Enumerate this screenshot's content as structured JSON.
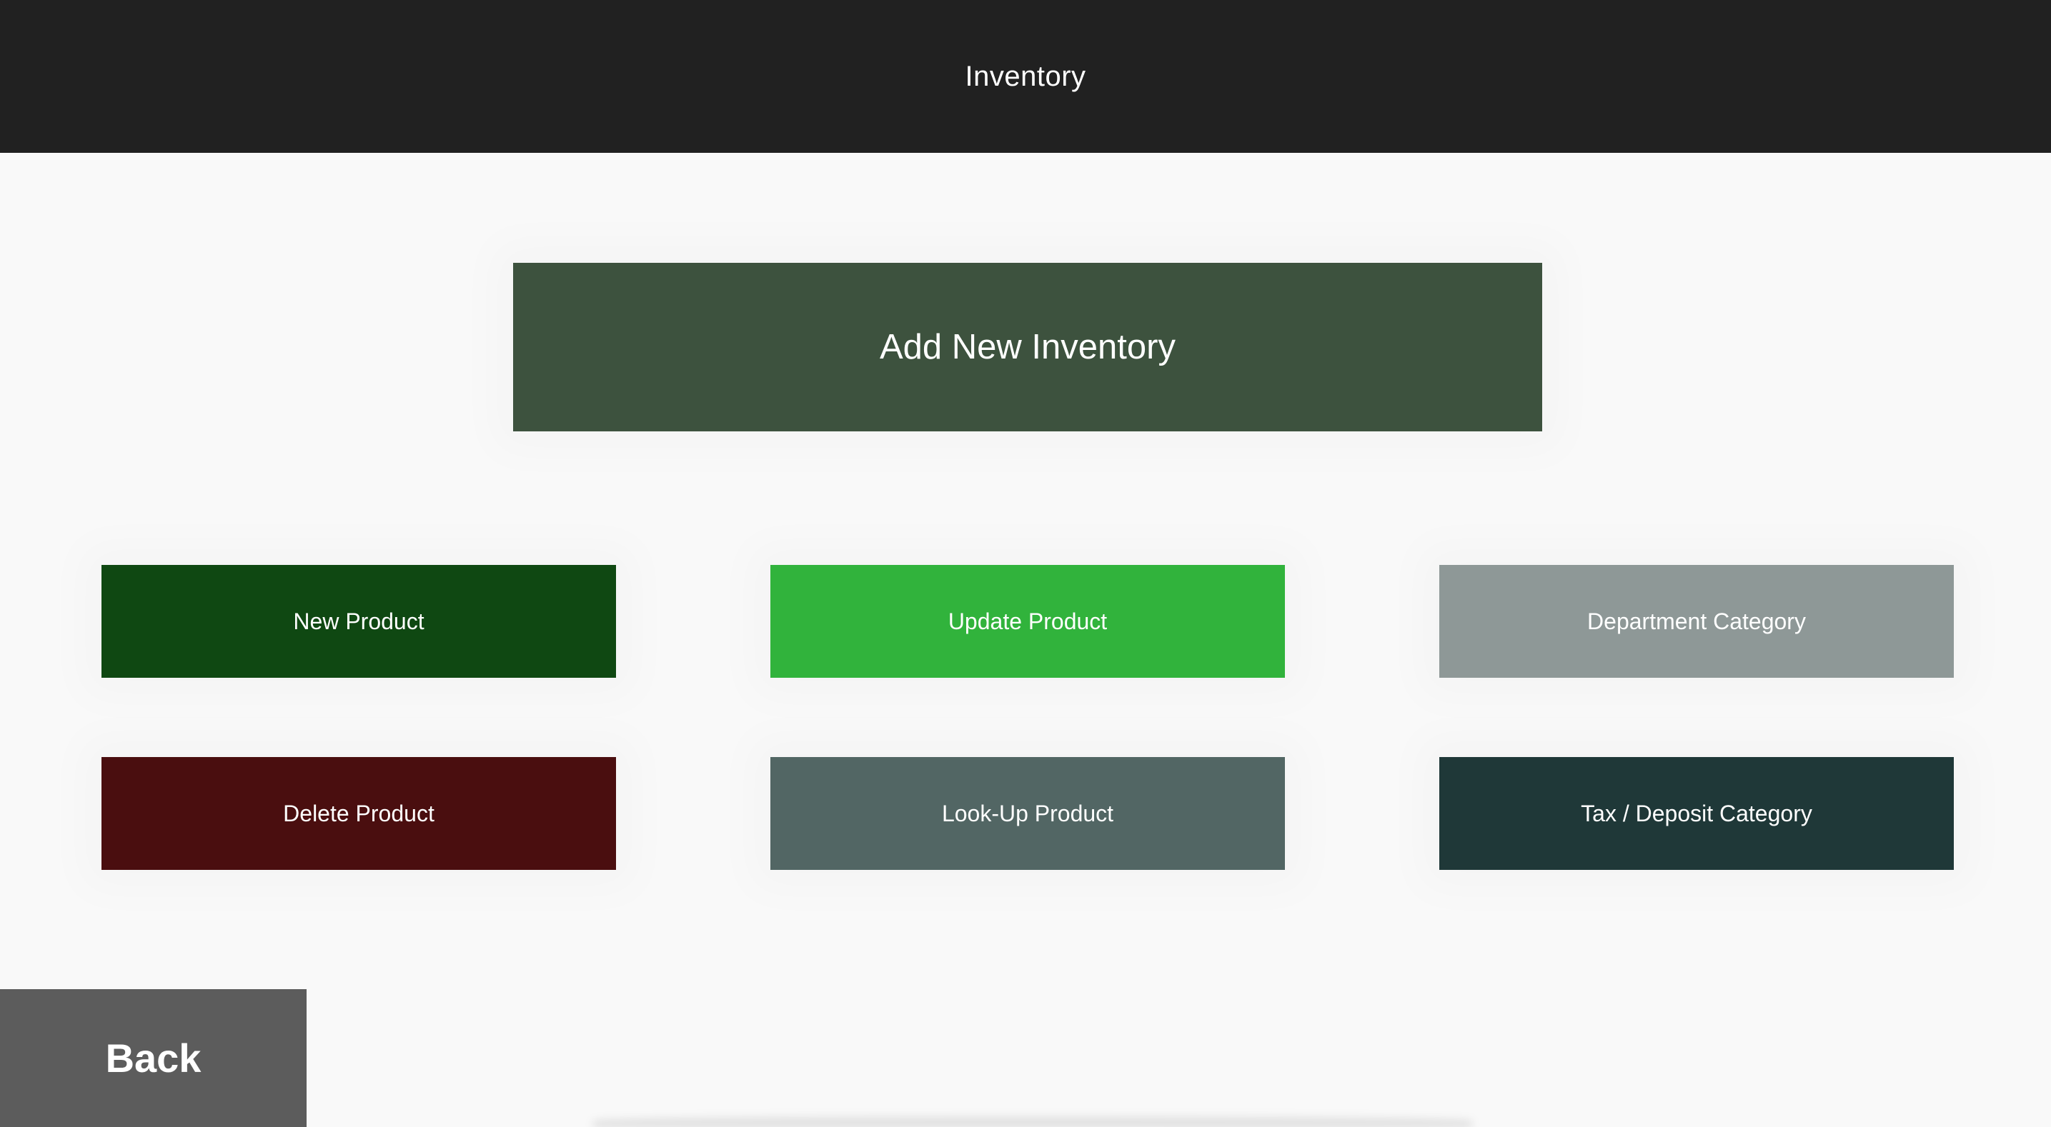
{
  "header": {
    "title": "Inventory"
  },
  "main": {
    "add_inventory": {
      "label": "Add New Inventory",
      "color": "#3d523e"
    },
    "actions": [
      {
        "label": "New Product",
        "color": "#0f4812"
      },
      {
        "label": "Update Product",
        "color": "#31b33c"
      },
      {
        "label": "Department Category",
        "color": "#8e9897"
      },
      {
        "label": "Delete Product",
        "color": "#4a0e0f"
      },
      {
        "label": "Look-Up Product",
        "color": "#526664"
      },
      {
        "label": "Tax / Deposit Category",
        "color": "#1f3838"
      }
    ]
  },
  "footer": {
    "back_label": "Back",
    "back_color": "#5c5c5c"
  },
  "colors": {
    "header_bg": "#212121",
    "page_bg": "#f9f9f9"
  }
}
